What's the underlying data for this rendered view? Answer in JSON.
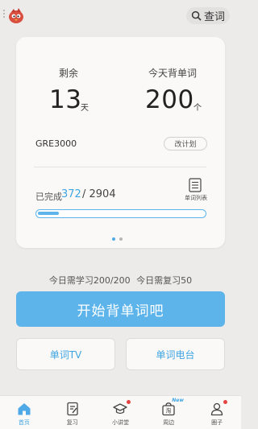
{
  "header": {
    "search_label": "查词"
  },
  "card": {
    "remaining_label": "剩余",
    "remaining_value": "13",
    "remaining_unit": "天",
    "today_label": "今天背单词",
    "today_value": "200",
    "today_unit": "个",
    "plan_name": "GRE3000",
    "change_plan_label": "改计划",
    "completed_label": "已完成",
    "completed_count": "372",
    "total_separator": "/ 2904",
    "word_list_label": "单词列表",
    "progress_fraction": 0.128
  },
  "pager": {
    "pages": 2,
    "active_index": 0
  },
  "daily": {
    "text": "今日需学习200/200  今日需复习50"
  },
  "actions": {
    "start_label": "开始背单词吧",
    "tv_label": "单词TV",
    "radio_label": "单词电台"
  },
  "tabbar": {
    "items": [
      {
        "label": "首页",
        "icon": "home-icon"
      },
      {
        "label": "复习",
        "icon": "review-icon"
      },
      {
        "label": "小讲堂",
        "icon": "graduation-cap-icon",
        "badge": "dot"
      },
      {
        "label": "周边",
        "icon": "shop-bag-icon",
        "badge": "New"
      },
      {
        "label": "圈子",
        "icon": "people-icon",
        "badge": "dot"
      }
    ]
  },
  "colors": {
    "accent": "#5cb4ea",
    "badge": "#e64340"
  }
}
